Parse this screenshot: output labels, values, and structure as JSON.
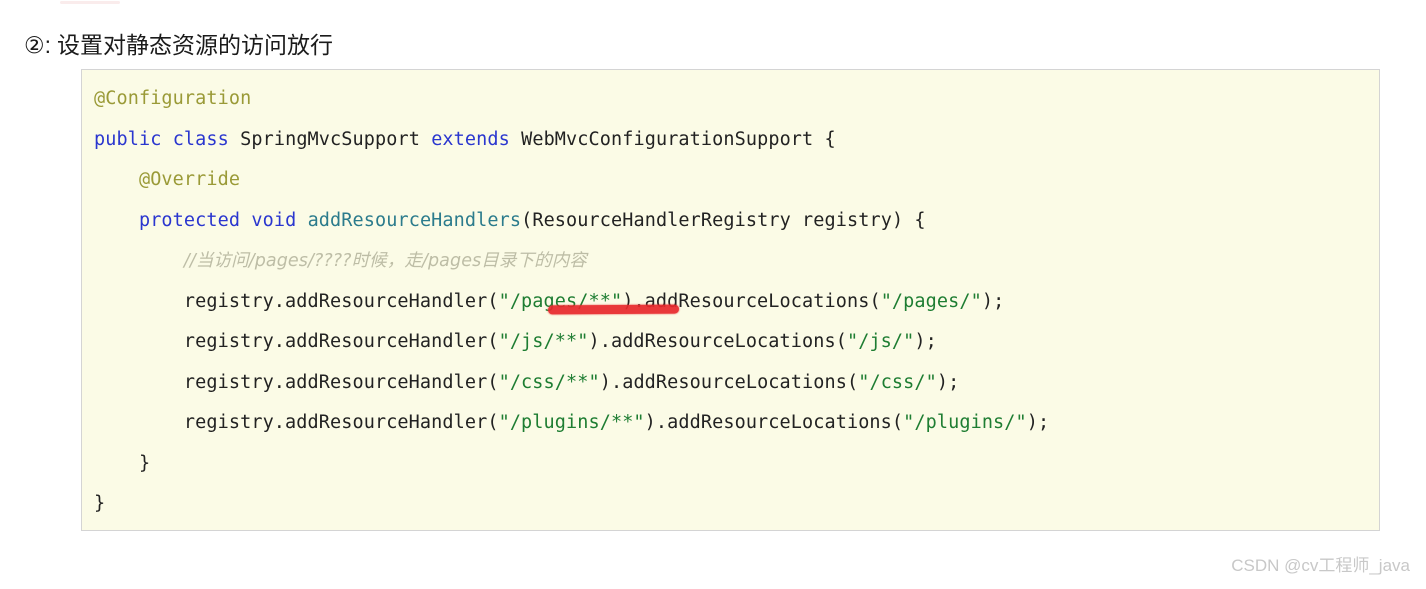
{
  "page": {
    "background_color": "#ffffff"
  },
  "heading": {
    "marker": "②:",
    "text": "设置对静态资源的访问放行"
  },
  "code_block": {
    "background_color": "#fbfbe6",
    "border_color": "#d4d4d4",
    "language": "java",
    "colors": {
      "annotation": "#9a9a37",
      "keyword": "#2a36cf",
      "method": "#2b7b8c",
      "string": "#1e7d32",
      "comment": "#bdbda6",
      "plain": "#222222"
    },
    "lines": [
      {
        "indent": 0,
        "tokens": [
          {
            "cls": "tok-ann",
            "t": "@Configuration"
          }
        ]
      },
      {
        "indent": 0,
        "tokens": [
          {
            "cls": "tok-kw",
            "t": "public"
          },
          {
            "cls": "tok-plain",
            "t": " "
          },
          {
            "cls": "tok-kw",
            "t": "class"
          },
          {
            "cls": "tok-plain",
            "t": " SpringMvcSupport "
          },
          {
            "cls": "tok-kw",
            "t": "extends"
          },
          {
            "cls": "tok-plain",
            "t": " WebMvcConfigurationSupport {"
          }
        ]
      },
      {
        "indent": 1,
        "tokens": [
          {
            "cls": "tok-ann",
            "t": "@Override"
          }
        ]
      },
      {
        "indent": 1,
        "tokens": [
          {
            "cls": "tok-kw",
            "t": "protected"
          },
          {
            "cls": "tok-plain",
            "t": " "
          },
          {
            "cls": "tok-kw",
            "t": "void"
          },
          {
            "cls": "tok-plain",
            "t": " "
          },
          {
            "cls": "tok-meth",
            "t": "addResourceHandlers"
          },
          {
            "cls": "tok-plain",
            "t": "(ResourceHandlerRegistry registry) {"
          }
        ]
      },
      {
        "indent": 2,
        "tokens": [
          {
            "cls": "tok-cmt",
            "t": "//当访问/pages/????时候，走/pages目录下的内容"
          }
        ]
      },
      {
        "indent": 2,
        "tokens": [
          {
            "cls": "tok-plain",
            "t": "registry.addResourceHandler("
          },
          {
            "cls": "tok-str",
            "t": "\"/pages/**\""
          },
          {
            "cls": "tok-plain",
            "t": ").addResourceLocations("
          },
          {
            "cls": "tok-str",
            "t": "\"/pages/\""
          },
          {
            "cls": "tok-plain",
            "t": ");"
          }
        ]
      },
      {
        "indent": 2,
        "tokens": [
          {
            "cls": "tok-plain",
            "t": "registry.addResourceHandler("
          },
          {
            "cls": "tok-str",
            "t": "\"/js/**\""
          },
          {
            "cls": "tok-plain",
            "t": ").addResourceLocations("
          },
          {
            "cls": "tok-str",
            "t": "\"/js/\""
          },
          {
            "cls": "tok-plain",
            "t": ");"
          }
        ]
      },
      {
        "indent": 2,
        "tokens": [
          {
            "cls": "tok-plain",
            "t": "registry.addResourceHandler("
          },
          {
            "cls": "tok-str",
            "t": "\"/css/**\""
          },
          {
            "cls": "tok-plain",
            "t": ").addResourceLocations("
          },
          {
            "cls": "tok-str",
            "t": "\"/css/\""
          },
          {
            "cls": "tok-plain",
            "t": ");"
          }
        ]
      },
      {
        "indent": 2,
        "tokens": [
          {
            "cls": "tok-plain",
            "t": "registry.addResourceHandler("
          },
          {
            "cls": "tok-str",
            "t": "\"/plugins/**\""
          },
          {
            "cls": "tok-plain",
            "t": ").addResourceLocations("
          },
          {
            "cls": "tok-str",
            "t": "\"/plugins/\""
          },
          {
            "cls": "tok-plain",
            "t": ");"
          }
        ]
      },
      {
        "indent": 1,
        "tokens": [
          {
            "cls": "tok-plain",
            "t": "}"
          }
        ]
      },
      {
        "indent": 0,
        "tokens": [
          {
            "cls": "tok-plain",
            "t": "}"
          }
        ]
      }
    ]
  },
  "annotations": {
    "red_underline": {
      "target_text": "\"/pages/**\"",
      "color": "#e8282c"
    }
  },
  "watermark": {
    "text": "CSDN @cv工程师_java",
    "color": "#c8c8c8"
  }
}
